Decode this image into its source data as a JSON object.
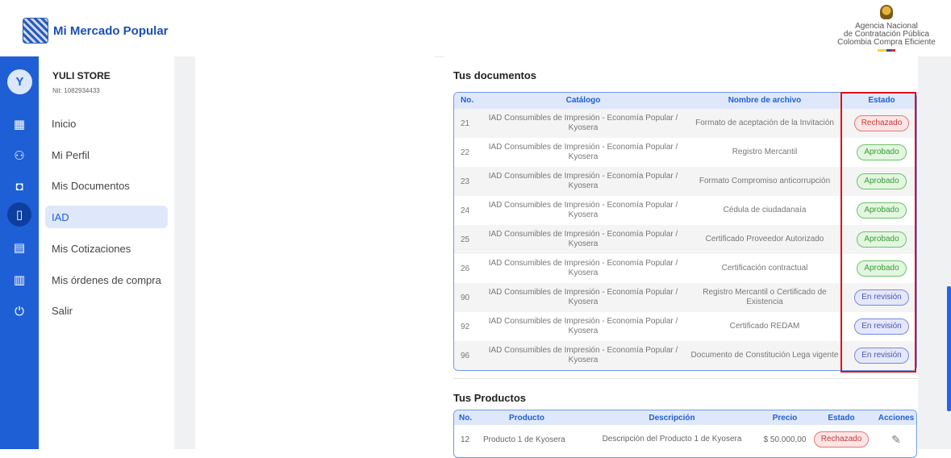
{
  "header": {
    "app_name": "Mi Mercado Popular",
    "agency_lines": [
      "Agencia Nacional",
      "de Contratación Pública",
      "Colombia Compra Eficiente"
    ]
  },
  "profile": {
    "avatar_letter": "Y",
    "store_name": "YULI STORE",
    "nit": "Nit: 1082934433"
  },
  "sidebar": {
    "items": [
      {
        "label": "Inicio",
        "icon": "dashboard-icon"
      },
      {
        "label": "Mi Perfil",
        "icon": "users-icon"
      },
      {
        "label": "Mis Documentos",
        "icon": "briefcase-icon"
      },
      {
        "label": "IAD",
        "icon": "document-icon",
        "active": true
      },
      {
        "label": "Mis Cotizaciones",
        "icon": "receipt-icon"
      },
      {
        "label": "Mis órdenes de compra",
        "icon": "clipboard-icon"
      },
      {
        "label": "Salir",
        "icon": "power-icon"
      }
    ]
  },
  "documents": {
    "title": "Tus documentos",
    "headers": {
      "no": "No.",
      "catalog": "Catálogo",
      "file": "Nombre de archivo",
      "status": "Estado"
    },
    "rows": [
      {
        "no": "21",
        "catalog": "IAD Consumibles de Impresión - Economía Popular / Kyosera",
        "file": "Formato de aceptación de la Invitación",
        "status": "Rechazado"
      },
      {
        "no": "22",
        "catalog": "IAD Consumibles de Impresión - Economía Popular / Kyosera",
        "file": "Registro Mercantil",
        "status": "Aprobado"
      },
      {
        "no": "23",
        "catalog": "IAD Consumibles de Impresión - Economía Popular / Kyosera",
        "file": "Formato Compromiso anticorrupción",
        "status": "Aprobado"
      },
      {
        "no": "24",
        "catalog": "IAD Consumibles de Impresión - Economía Popular / Kyosera",
        "file": "Cédula de ciudadanaía",
        "status": "Aprobado"
      },
      {
        "no": "25",
        "catalog": "IAD Consumibles de Impresión - Economía Popular / Kyosera",
        "file": "Certificado Proveedor Autorizado",
        "status": "Aprobado"
      },
      {
        "no": "26",
        "catalog": "IAD Consumibles de Impresión - Economía Popular / Kyosera",
        "file": "Certificación contractual",
        "status": "Aprobado"
      },
      {
        "no": "90",
        "catalog": "IAD Consumibles de Impresión - Economía Popular / Kyosera",
        "file": "Registro Mercantil o Certificado de Existencia",
        "status": "En revisión"
      },
      {
        "no": "92",
        "catalog": "IAD Consumibles de Impresión - Economía Popular / Kyosera",
        "file": "Certificado REDAM",
        "status": "En revisión"
      },
      {
        "no": "96",
        "catalog": "IAD Consumibles de Impresión - Economía Popular / Kyosera",
        "file": "Documento de Constitución Lega vigente",
        "status": "En revisión"
      }
    ]
  },
  "products": {
    "title": "Tus Productos",
    "headers": {
      "no": "No.",
      "product": "Producto",
      "description": "Descripción",
      "price": "Precio",
      "status": "Estado",
      "actions": "Acciones"
    },
    "rows": [
      {
        "no": "12",
        "product": "Producto 1 de Kyosera",
        "description": "Descripción del Producto 1 de Kyosera",
        "price": "$ 50.000,00",
        "status": "Rechazado",
        "action_icon": "edit-icon"
      }
    ]
  }
}
